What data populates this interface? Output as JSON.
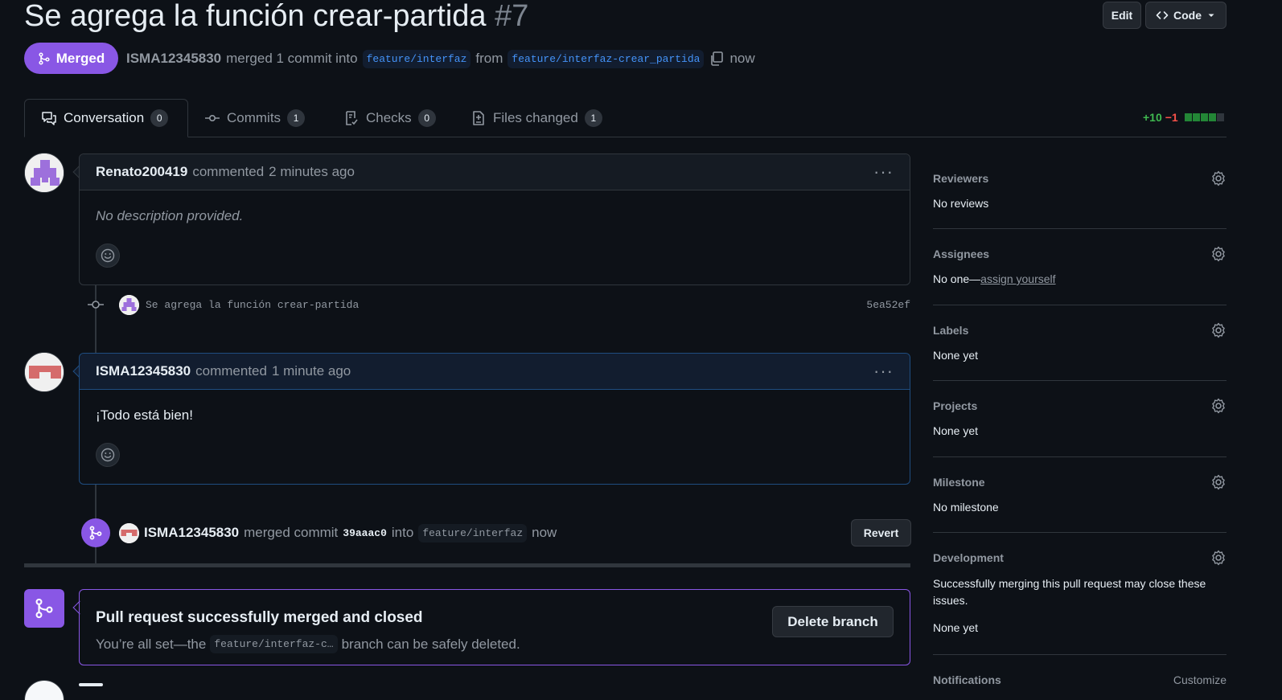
{
  "pr": {
    "title": "Se agrega la función crear-partida",
    "number": "#7",
    "state": "Merged",
    "author": "ISMA12345830",
    "merged_text": "merged 1 commit into",
    "base_branch": "feature/interfaz",
    "from_text": "from",
    "head_branch": "feature/interfaz-crear_partida",
    "time": "now"
  },
  "header_buttons": {
    "edit": "Edit",
    "code": "Code"
  },
  "tabs": [
    {
      "label": "Conversation",
      "count": "0",
      "icon": "comment-discussion-icon"
    },
    {
      "label": "Commits",
      "count": "1",
      "icon": "git-commit-icon"
    },
    {
      "label": "Checks",
      "count": "0",
      "icon": "checklist-icon"
    },
    {
      "label": "Files changed",
      "count": "1",
      "icon": "file-diff-icon"
    }
  ],
  "diffstat": {
    "additions": "+10",
    "deletions": "−1",
    "blocks": [
      "green",
      "green",
      "green",
      "green",
      "grey"
    ]
  },
  "timeline": {
    "comment1": {
      "author": "Renato200419",
      "action": "commented",
      "time": "2 minutes ago",
      "body": "No description provided."
    },
    "commit": {
      "message": "Se agrega la función crear-partida",
      "sha": "5ea52ef"
    },
    "comment2": {
      "author": "ISMA12345830",
      "action": "commented",
      "time": "1 minute ago",
      "body": "¡Todo está bien!"
    },
    "merge_event": {
      "author": "ISMA12345830",
      "action": "merged commit",
      "sha": "39aaac0",
      "into": "into",
      "branch": "feature/interfaz",
      "time": "now",
      "revert": "Revert"
    },
    "merged_box": {
      "title": "Pull request successfully merged and closed",
      "text_before": "You’re all set—the",
      "branch": "feature/interfaz-c…",
      "text_after": "branch can be safely deleted.",
      "delete_button": "Delete branch"
    }
  },
  "sidebar": {
    "reviewers": {
      "title": "Reviewers",
      "value": "No reviews"
    },
    "assignees": {
      "title": "Assignees",
      "value": "No one—",
      "link": "assign yourself"
    },
    "labels": {
      "title": "Labels",
      "value": "None yet"
    },
    "projects": {
      "title": "Projects",
      "value": "None yet"
    },
    "milestone": {
      "title": "Milestone",
      "value": "No milestone"
    },
    "development": {
      "title": "Development",
      "description": "Successfully merging this pull request may close these issues.",
      "value": "None yet"
    },
    "notifications": {
      "title": "Notifications",
      "action": "Customize"
    }
  },
  "colors": {
    "merged": "#8957e5",
    "accent_blue": "#4493f8",
    "add": "#3fb950",
    "del": "#f85149"
  }
}
